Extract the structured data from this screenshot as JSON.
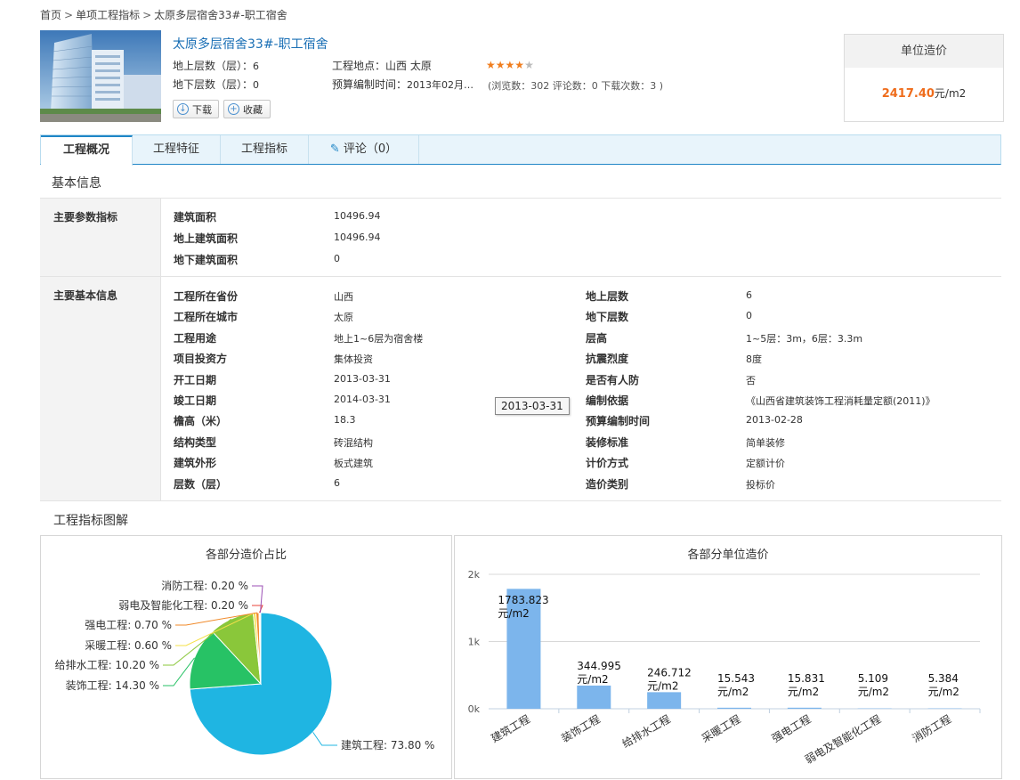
{
  "breadcrumb": [
    "首页",
    "单项工程指标",
    "太原多层宿舍33#-职工宿舍"
  ],
  "header": {
    "title": "太原多层宿舍33#-职工宿舍",
    "above_label": "地上层数（层）：",
    "above_value": "6",
    "below_label": "地下层数（层）：",
    "below_value": "0",
    "location_label": "工程地点：",
    "location_value": "山西  太原",
    "budget_time_label": "预算编制时间：",
    "budget_time_value": "2013年02月…",
    "rating": 4,
    "rating_max": 5,
    "stats": "(浏览数：302  评论数：0  下载次数：3 )",
    "download_label": "下载",
    "collect_label": "收藏"
  },
  "price": {
    "title": "单位造价",
    "value": "2417.40",
    "unit": "元/m2"
  },
  "tabs": [
    "工程概况",
    "工程特征",
    "工程指标",
    "评论（0）"
  ],
  "sections": {
    "basic": "基本信息",
    "chart": "工程指标图解"
  },
  "main_params": {
    "label": "主要参数指标",
    "rows": [
      {
        "k": "建筑面积",
        "v": "10496.94"
      },
      {
        "k": "地上建筑面积",
        "v": "10496.94"
      },
      {
        "k": "地下建筑面积",
        "v": "0"
      }
    ]
  },
  "main_info": {
    "label": "主要基本信息",
    "left": [
      {
        "k": "工程所在省份",
        "v": "山西"
      },
      {
        "k": "工程所在城市",
        "v": "太原"
      },
      {
        "k": "工程用途",
        "v": "地上1~6层为宿舍楼"
      },
      {
        "k": "项目投资方",
        "v": "集体投资"
      },
      {
        "k": "开工日期",
        "v": "2013-03-31"
      },
      {
        "k": "竣工日期",
        "v": "2014-03-31"
      },
      {
        "k": "檐高（米）",
        "v": "18.3"
      },
      {
        "k": "结构类型",
        "v": "砖混结构"
      },
      {
        "k": "建筑外形",
        "v": "板式建筑"
      },
      {
        "k": "层数（层）",
        "v": "6"
      }
    ],
    "right": [
      {
        "k": "地上层数",
        "v": "6"
      },
      {
        "k": "地下层数",
        "v": "0"
      },
      {
        "k": "层高",
        "v": "1~5层：3m，6层：3.3m"
      },
      {
        "k": "抗震烈度",
        "v": "8度"
      },
      {
        "k": "是否有人防",
        "v": "否"
      },
      {
        "k": "编制依据",
        "v": "《山西省建筑装饰工程消耗量定额(2011)》"
      },
      {
        "k": "预算编制时间",
        "v": "2013-02-28"
      },
      {
        "k": "装修标准",
        "v": "简单装修"
      },
      {
        "k": "计价方式",
        "v": "定额计价"
      },
      {
        "k": "造价类别",
        "v": "投标价"
      }
    ],
    "tooltip": "2013-03-31"
  },
  "colors": {
    "accent": "#1f86c6",
    "price": "#ef6c1b",
    "bar": "#7cb5ec"
  },
  "chart_data": [
    {
      "type": "pie",
      "title": "各部分造价占比",
      "unit": "%",
      "slices": [
        {
          "label": "建筑工程",
          "value": 73.8,
          "color": "#1fb5e2"
        },
        {
          "label": "装饰工程",
          "value": 14.3,
          "color": "#27c265"
        },
        {
          "label": "给排水工程",
          "value": 10.2,
          "color": "#8ac73a"
        },
        {
          "label": "采暖工程",
          "value": 0.6,
          "color": "#f5e04a"
        },
        {
          "label": "强电工程",
          "value": 0.7,
          "color": "#f08a2a"
        },
        {
          "label": "弱电及智能化工程",
          "value": 0.2,
          "color": "#e8463a"
        },
        {
          "label": "消防工程",
          "value": 0.2,
          "color": "#9b4fb5"
        }
      ]
    },
    {
      "type": "bar",
      "title": "各部分单位造价",
      "categories": [
        "建筑工程",
        "装饰工程",
        "给排水工程",
        "采暖工程",
        "强电工程",
        "弱电及智能化工程",
        "消防工程"
      ],
      "values": [
        1783.823,
        344.995,
        246.712,
        15.543,
        15.831,
        5.109,
        5.384
      ],
      "value_labels": [
        "1783.823",
        "344.995",
        "246.712",
        "15.543",
        "15.831",
        "5.109",
        "5.384"
      ],
      "value_unit": "元/m2",
      "yticks": [
        "0k",
        "1k",
        "2k"
      ],
      "ylim": [
        0,
        2000
      ]
    }
  ]
}
